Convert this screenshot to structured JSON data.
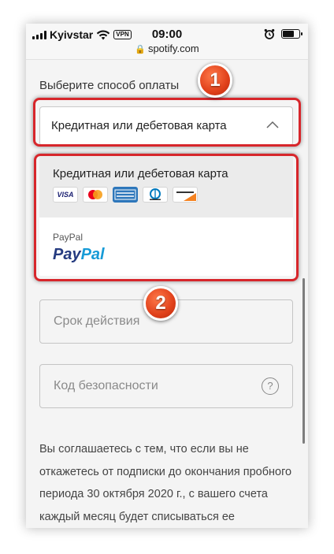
{
  "status_bar": {
    "carrier": "Kyivstar",
    "vpn": "VPN",
    "time": "09:00",
    "icons": [
      "signal-icon",
      "wifi-icon",
      "alarm-icon",
      "battery-icon"
    ]
  },
  "url_bar": {
    "url": "spotify.com",
    "icon": "lock-icon"
  },
  "payment": {
    "label": "Выберите способ оплаты",
    "selected": "Кредитная или дебетовая карта",
    "options": [
      {
        "title": "Кредитная или дебетовая карта",
        "card_logos": [
          "VISA",
          "Mastercard",
          "American Express",
          "Diners Club",
          "Discover"
        ]
      },
      {
        "title": "PayPal",
        "logo_pay": "Pay",
        "logo_pal": "Pal"
      }
    ]
  },
  "fields": {
    "expiry_placeholder": "Срок действия",
    "cvv_placeholder": "Код безопасности",
    "cvv_help": "?"
  },
  "terms": "Вы соглашаетесь с тем, что если вы не откажетесь от подписки до окончания пробного периода 30 октября 2020 г., с вашего счета каждый месяц будет списываться ее стоимость. Полные",
  "annotations": {
    "badge1": "1",
    "badge2": "2"
  },
  "colors": {
    "highlight": "#d7262b",
    "badge": "#e0401a",
    "paypal_dark": "#253b80",
    "paypal_light": "#179bd7"
  }
}
